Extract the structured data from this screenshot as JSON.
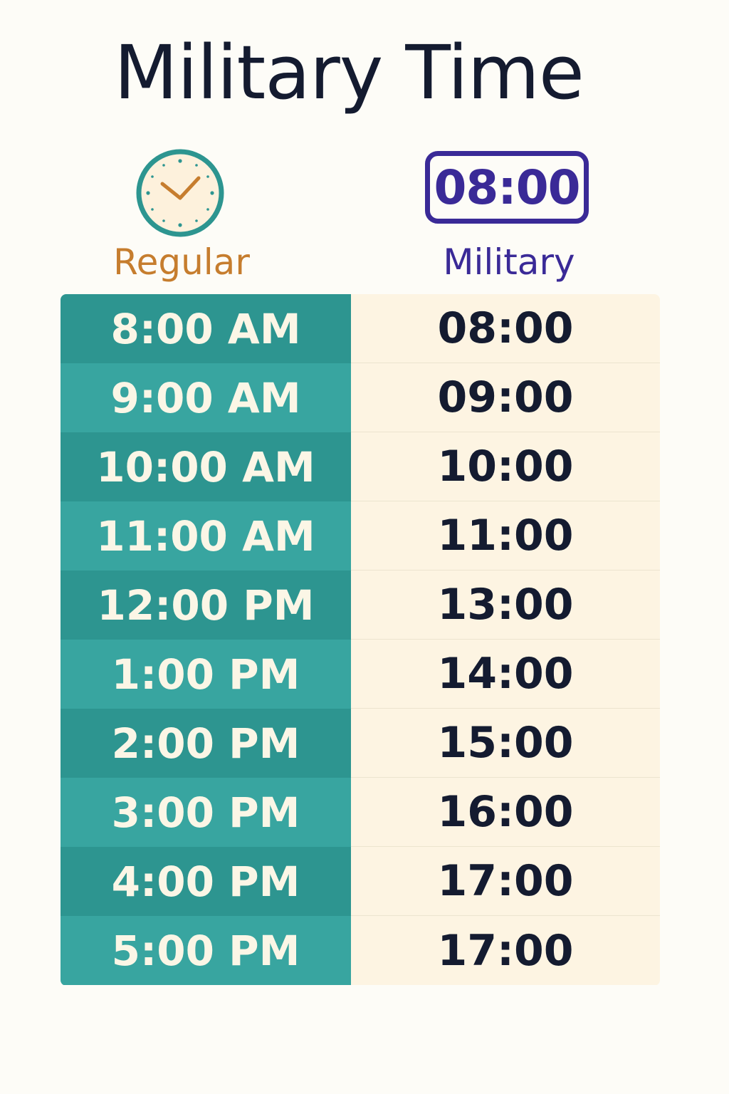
{
  "header": {
    "title": "Military Time"
  },
  "columns": {
    "regular": {
      "label": "Regular",
      "icon": "clock-icon",
      "color": "#c67d2e"
    },
    "military": {
      "label": "Military",
      "icon_text": "08:00",
      "color": "#3a2a97"
    }
  },
  "table": {
    "rows": [
      {
        "regular": "8:00 AM",
        "military": "08:00"
      },
      {
        "regular": "9:00 AM",
        "military": "09:00"
      },
      {
        "regular": "10:00 AM",
        "military": "10:00"
      },
      {
        "regular": "11:00 AM",
        "military": "11:00"
      },
      {
        "regular": "12:00 PM",
        "military": "13:00"
      },
      {
        "regular": "1:00 PM",
        "military": "14:00"
      },
      {
        "regular": "2:00 PM",
        "military": "15:00"
      },
      {
        "regular": "3:00 PM",
        "military": "16:00"
      },
      {
        "regular": "4:00 PM",
        "military": "17:00"
      },
      {
        "regular": "5:00 PM",
        "military": "17:00"
      }
    ]
  },
  "colors": {
    "teal": "#2d9590",
    "teal_light": "#38a5a0",
    "cream": "#fdf4e2",
    "navy": "#141b30"
  }
}
